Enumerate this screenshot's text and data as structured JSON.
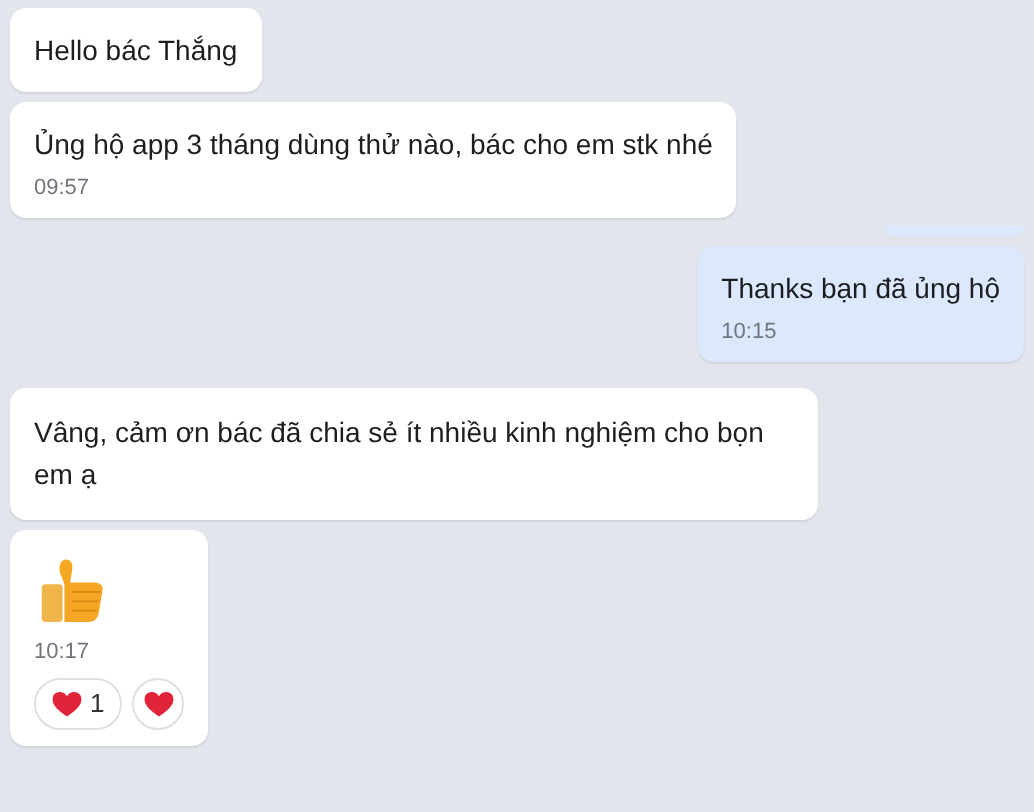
{
  "messages": [
    {
      "kind": "text",
      "outgoing": false,
      "text": "Hello bác Thắng"
    },
    {
      "kind": "text",
      "outgoing": false,
      "text": "Ủng hộ app 3 tháng dùng thử nào, bác cho em stk nhé",
      "time": "09:57"
    },
    {
      "kind": "edge",
      "outgoing": true
    },
    {
      "kind": "text",
      "outgoing": true,
      "text": "Thanks bạn đã ủng hộ",
      "time": "10:15"
    },
    {
      "kind": "text",
      "outgoing": false,
      "text": "Vâng, cảm ơn bác đã chia sẻ ít nhiều kinh nghiệm cho bọn em ạ"
    },
    {
      "kind": "sticker",
      "outgoing": false,
      "time": "10:17",
      "reactions": [
        {
          "kind": "count",
          "count": "1"
        },
        {
          "kind": "add"
        }
      ]
    }
  ]
}
